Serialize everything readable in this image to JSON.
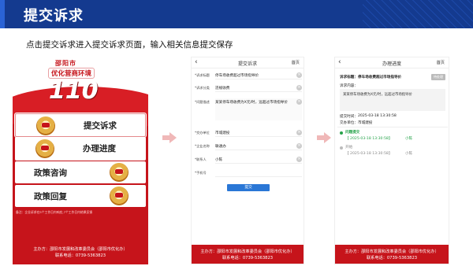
{
  "slide": {
    "title": "提交诉求",
    "subtitle": "点击提交诉求进入提交诉求页面，输入相关信息提交保存"
  },
  "home": {
    "city": "邵阳市",
    "slogan": "优化营商环境",
    "number": "110",
    "menu": [
      {
        "label": "提交诉求",
        "selected": true
      },
      {
        "label": "办理进度",
        "selected": false
      },
      {
        "label": "政策咨询",
        "selected": false
      },
      {
        "label": "政策回复",
        "selected": false
      }
    ],
    "note": "备注：企业诉求在5个工作日内响应,7个工作日内结果反馈",
    "footer_org": "主办方：邵阳市发展和改革委员会（邵阳市优化办）",
    "footer_phone": "联系电话：0739-5363823"
  },
  "form": {
    "nav_back": "‹",
    "nav_title": "提交诉求",
    "nav_home": "首页",
    "fields": [
      {
        "label": "*诉求标题",
        "value": "停车场收费超过市场指导价",
        "clear": "×"
      },
      {
        "label": "*诉求分类",
        "value": "违规收费",
        "clear": "×"
      },
      {
        "label": "*问题描述",
        "value": "某某停车场收费为X元/时，远超过市场指导价",
        "clear": "×"
      },
      {
        "label": "*交办单位",
        "value": "市城建投",
        "clear": "×"
      },
      {
        "label": "*企业名称",
        "value": "联通办",
        "clear": "×"
      },
      {
        "label": "*联系人",
        "value": "小陈",
        "clear": "×"
      },
      {
        "label": "*手机号",
        "value": "",
        "clear": ""
      }
    ],
    "submit_label": "提交",
    "footer_org": "主办方：邵阳市发展和改革委员会（邵阳市优化办）",
    "footer_phone": "联系电话：0739-5363823"
  },
  "progress": {
    "nav_back": "‹",
    "nav_title": "办理进度",
    "nav_home": "首页",
    "title_label": "诉求标题：",
    "title_value": "停车场收费超过市场指导价",
    "status_chip": "待处理",
    "content_label": "诉求内容：",
    "content_value": "某某停车场收费为X元/时，远超过市场指导价",
    "submit_time_label": "提交时间：",
    "submit_time": "2025-03-18 13:30:58",
    "unit_label": "交办单位：",
    "unit_value": "市城建投",
    "timeline": [
      {
        "title": "问题提交",
        "time": "【 2025-03-18 13:30:58】",
        "person": "小陈",
        "active": true
      },
      {
        "title": "开始",
        "time": "【 2025-03-18 13:30:58】",
        "person": "小陈",
        "active": false
      }
    ],
    "footer_org": "主办方：邵阳市发展和改革委员会（邵阳市优化办）",
    "footer_phone": "联系电话：0739-5363823"
  },
  "colors": {
    "brand_red": "#c6141b",
    "header_blue": "#143a8f",
    "button_blue": "#2a77d6",
    "active_green": "#26a34a"
  }
}
